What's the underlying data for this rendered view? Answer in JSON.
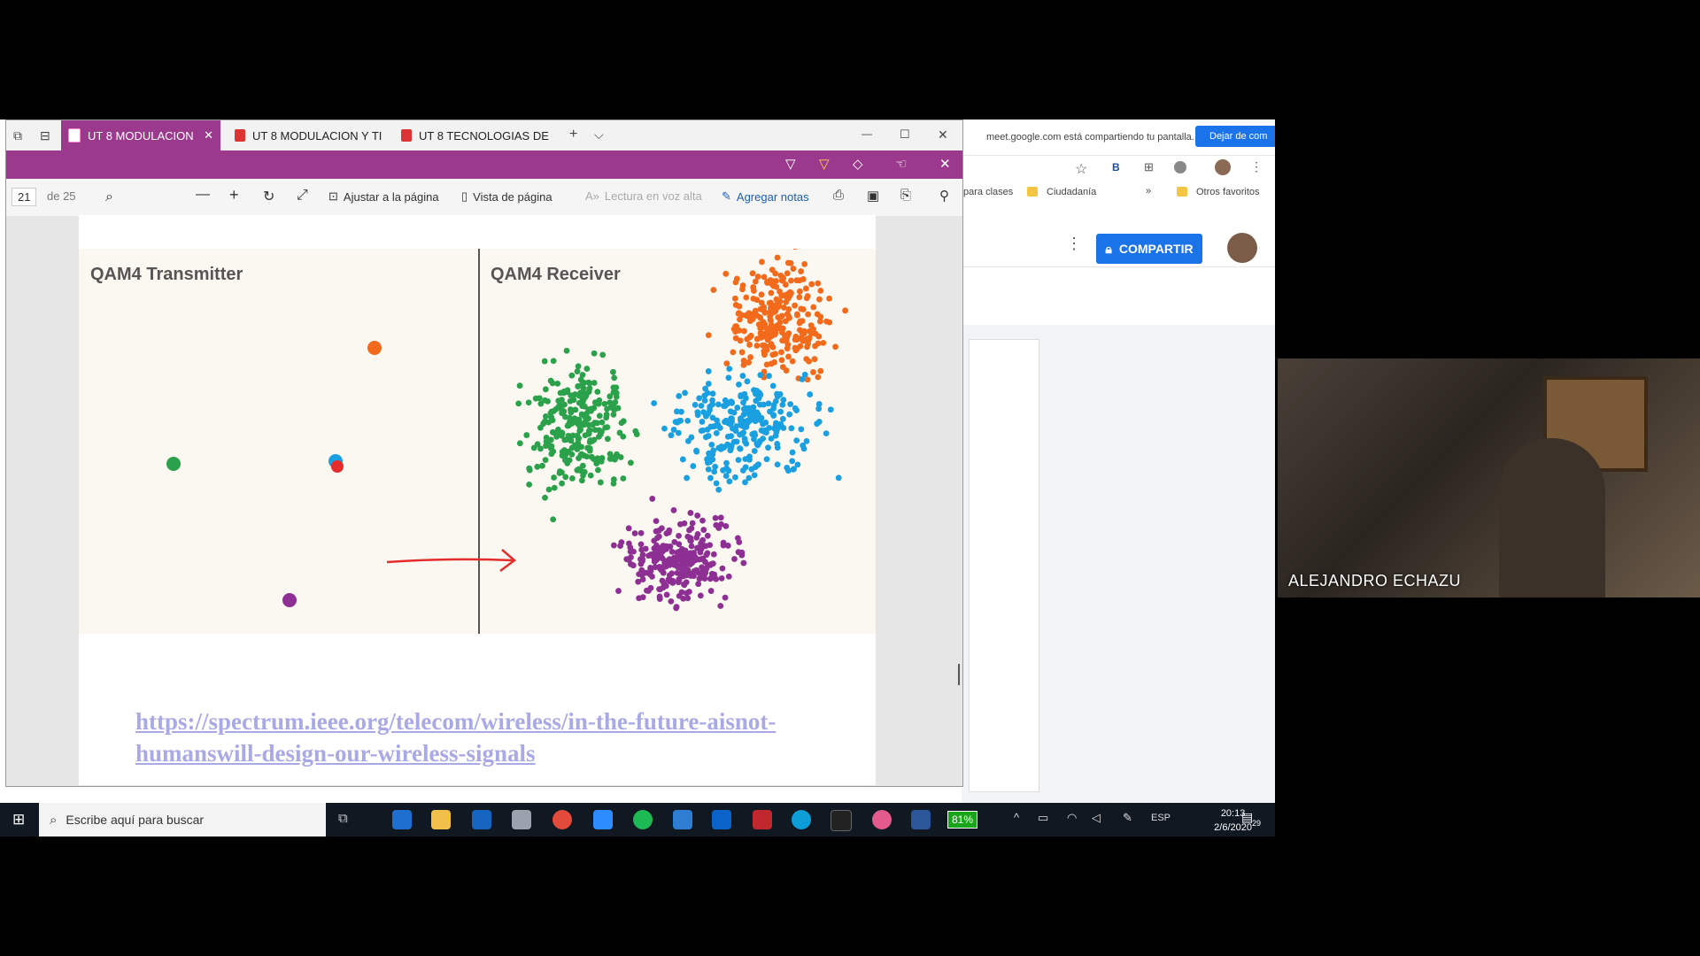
{
  "screen_share": {
    "banner_text": "meet.google.com está compartiendo tu pantalla.",
    "banner_button": "Dejar de com",
    "bookmarks": [
      "para clases",
      "Ciudadanía",
      "»",
      "Otros favoritos"
    ],
    "compartir_label": "COMPARTIR"
  },
  "edge": {
    "tabs": [
      {
        "label": "UT 8 MODULACION",
        "active": true
      },
      {
        "label": "UT 8 MODULACION Y TI",
        "active": false
      },
      {
        "label": "UT 8 TECNOLOGIAS DE",
        "active": false
      }
    ],
    "new_tab": "+",
    "tab_menu": "⌵",
    "window_controls": {
      "minimize": "—",
      "maximize": "☐",
      "close": "✕"
    },
    "pdf_toolbar": {
      "page_current": "21",
      "page_total": "de 25",
      "fit_page": "Ajustar a la página",
      "page_view": "Vista de página",
      "read_aloud": "Lectura en voz alta",
      "add_notes": "Agregar notas"
    }
  },
  "figure": {
    "left_title": "QAM4 Transmitter",
    "right_title": "QAM4 Receiver",
    "colors": {
      "orange": "#f26a1b",
      "green": "#2aa14a",
      "blue": "#1aa0e0",
      "purple": "#8e2f93",
      "red": "#e32c2c"
    }
  },
  "link_text": "https://spectrum.ieee.org/telecom/wireless/in-the-future-aisnot-humanswill-design-our-wireless-signals",
  "taskbar": {
    "search_placeholder": "Escribe aquí para buscar",
    "battery": "81%",
    "language": "ESP",
    "time": "20:13",
    "date": "2/6/2020",
    "notifications": "29"
  },
  "video": {
    "participant_name": "ALEJANDRO ECHAZU"
  }
}
